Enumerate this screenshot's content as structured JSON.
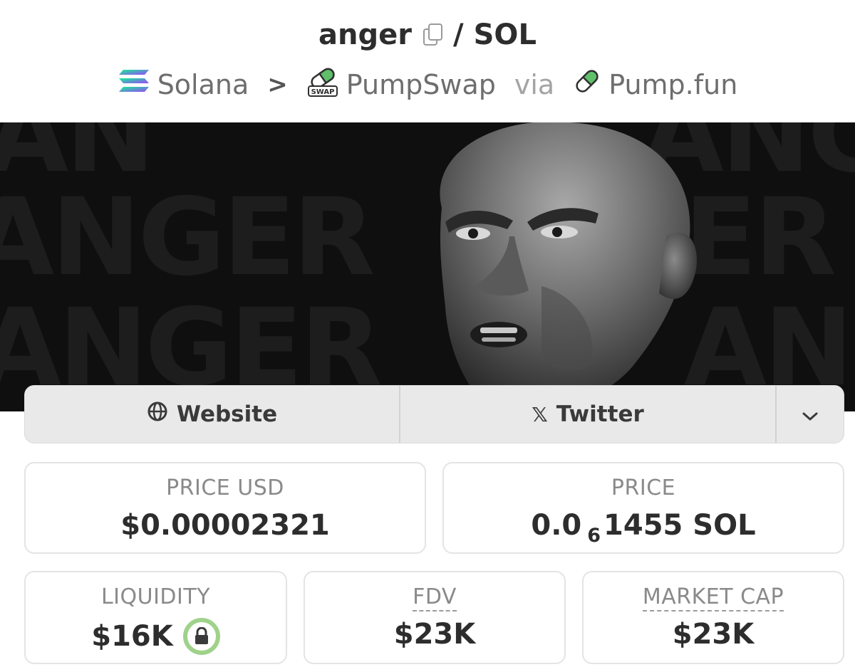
{
  "header": {
    "token_name": "anger",
    "separator": "/",
    "quote_token": "SOL",
    "chain": "Solana",
    "chevron": ">",
    "dex": "PumpSwap",
    "dex_badge": "SWAP",
    "via": "via",
    "launchpad": "Pump.fun"
  },
  "banner": {
    "background_words": [
      "ANGER",
      "ANGER",
      "ANGER",
      "ANGER",
      "AN",
      "ER",
      "ANG"
    ]
  },
  "links": {
    "website": "Website",
    "twitter": "Twitter",
    "twitter_icon": "𝕏",
    "more_icon": "chevron-down"
  },
  "stats": {
    "price_usd": {
      "label": "PRICE USD",
      "value": "$0.00002321"
    },
    "price": {
      "label": "PRICE",
      "value_prefix": "0.0",
      "value_subscript": "6",
      "value_suffix": "1455 SOL"
    },
    "liquidity": {
      "label": "LIQUIDITY",
      "value": "$16K"
    },
    "fdv": {
      "label": "FDV",
      "value": "$23K"
    },
    "market_cap": {
      "label": "MARKET CAP",
      "value": "$23K"
    }
  },
  "colors": {
    "lock_badge": "#9fd28a",
    "pump_green": "#5fbf6a",
    "solana_purple": "#9945ff",
    "solana_teal": "#14f195"
  }
}
